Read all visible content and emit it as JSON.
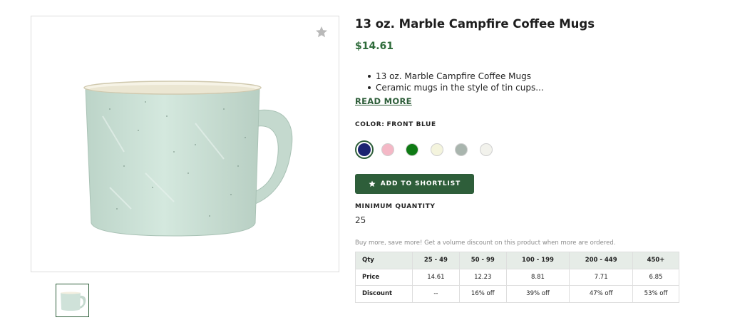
{
  "product": {
    "title": "13 oz. Marble Campfire Coffee Mugs",
    "price": "$14.61",
    "bullets": [
      "13 oz. Marble Campfire Coffee Mugs",
      "Ceramic mugs in the style of tin cups..."
    ],
    "read_more": "READ MORE"
  },
  "color": {
    "label": "COLOR:",
    "selected": "FRONT BLUE",
    "swatches": [
      {
        "hex": "#1c2472",
        "selected": true
      },
      {
        "hex": "#f4b8c6",
        "selected": false
      },
      {
        "hex": "#0f7a14",
        "selected": false
      },
      {
        "hex": "#f4f4dd",
        "selected": false
      },
      {
        "hex": "#a9b5ae",
        "selected": false
      },
      {
        "hex": "#f2f2ec",
        "selected": false
      }
    ]
  },
  "actions": {
    "add_to_shortlist": "ADD TO SHORTLIST",
    "icon": "star-icon"
  },
  "minimum": {
    "label": "MINIMUM QUANTITY",
    "value": "25"
  },
  "pricing": {
    "promo": "Buy more, save more! Get a volume discount on this product when more are ordered.",
    "header": [
      "Qty",
      "25 - 49",
      "50 - 99",
      "100 - 199",
      "200 - 449",
      "450+"
    ],
    "rows": [
      [
        "Price",
        "14.61",
        "12.23",
        "8.81",
        "7.71",
        "6.85"
      ],
      [
        "Discount",
        "--",
        "16% off",
        "39% off",
        "47% off",
        "53% off"
      ]
    ]
  },
  "colors": {
    "brand": "#2e5e3a",
    "price": "#2e6b3a",
    "mug": "#cfe2d9"
  }
}
